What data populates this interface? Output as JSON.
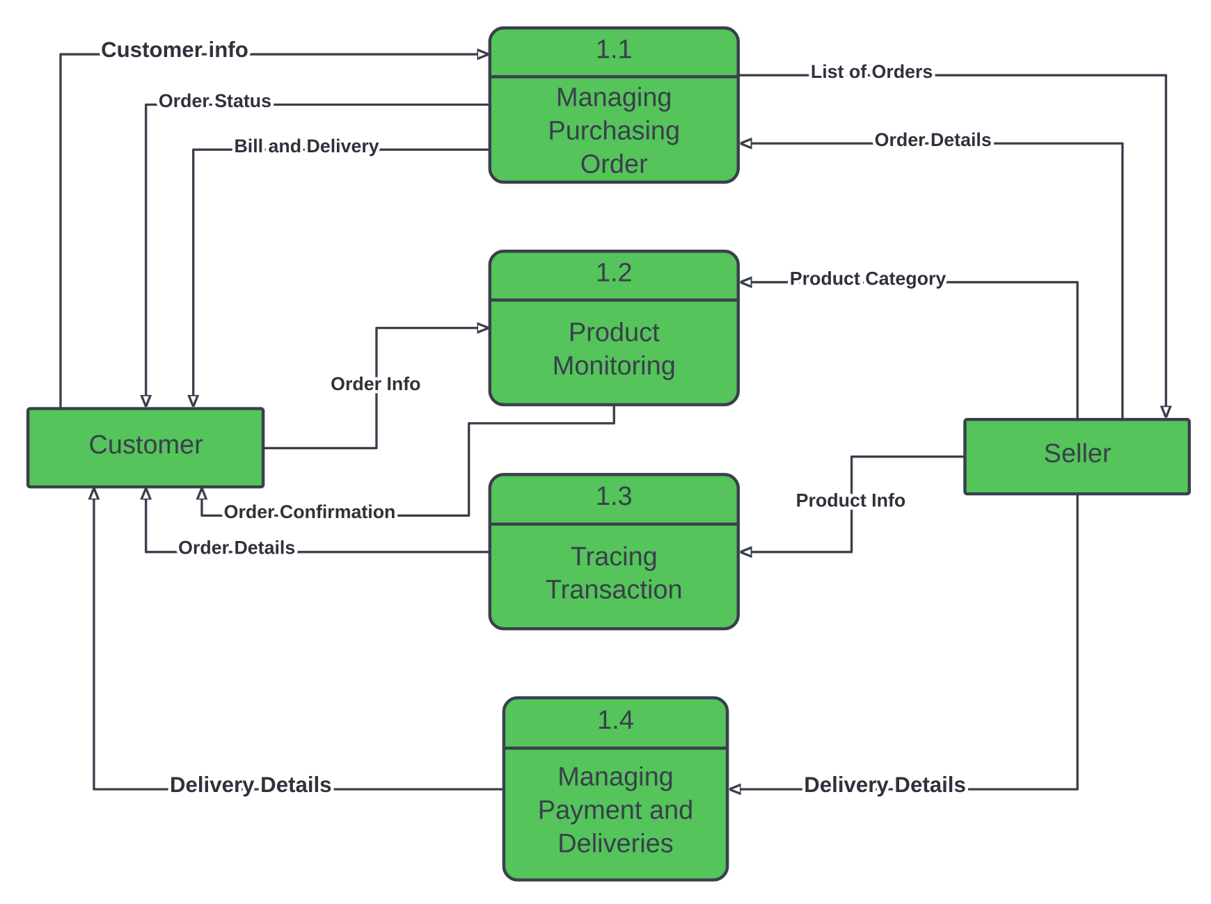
{
  "colors": {
    "process_fill": "#54c45b",
    "stroke": "#3a3f4b",
    "background": "#ffffff"
  },
  "entities": {
    "customer": "Customer",
    "seller": "Seller"
  },
  "processes": [
    {
      "id": "1.1",
      "lines": [
        "Managing",
        "Purchasing",
        "Order"
      ]
    },
    {
      "id": "1.2",
      "lines": [
        "Product",
        "Monitoring"
      ]
    },
    {
      "id": "1.3",
      "lines": [
        "Tracing",
        "Transaction"
      ]
    },
    {
      "id": "1.4",
      "lines": [
        "Managing",
        "Payment and",
        "Deliveries"
      ]
    }
  ],
  "flows": {
    "customer_info": "Customer info",
    "order_status": "Order Status",
    "bill_delivery": "Bill and Delivery",
    "list_of_orders": "List of Orders",
    "order_details_seller": "Order Details",
    "product_category": "Product Category",
    "order_info": "Order Info",
    "order_confirmation": "Order Confirmation",
    "order_details_customer": "Order Details",
    "product_info": "Product Info",
    "delivery_details_customer": "Delivery Details",
    "delivery_details_seller": "Delivery Details"
  }
}
